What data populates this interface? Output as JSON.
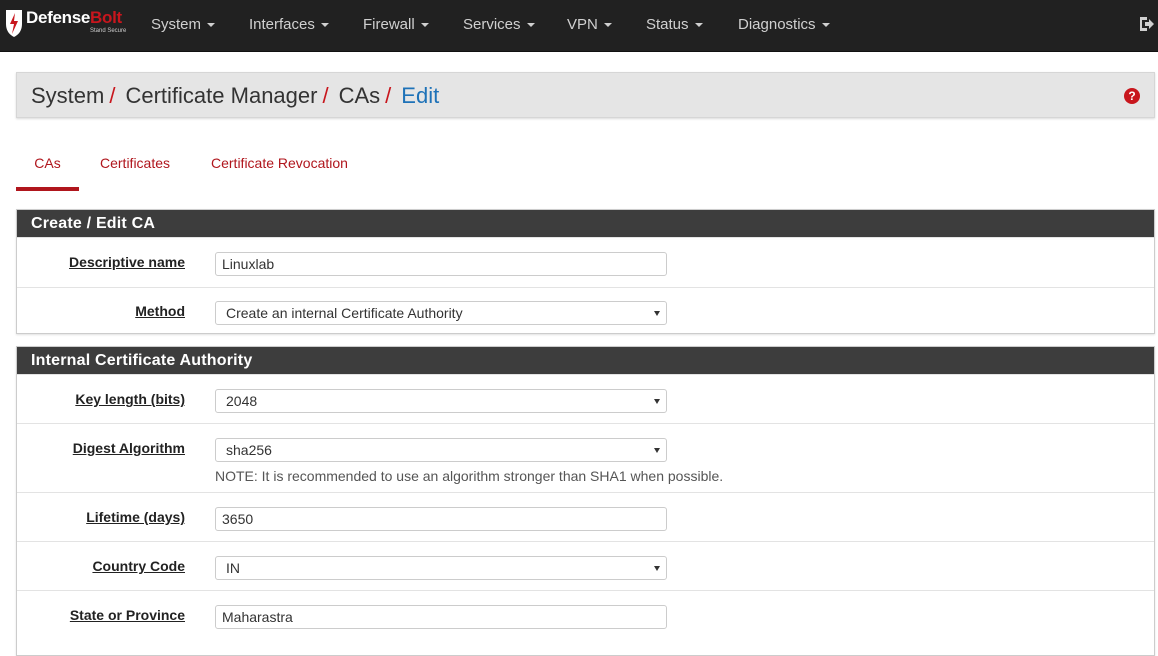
{
  "brand": {
    "name_white": "Defense",
    "name_red": "Bolt",
    "tagline": "Stand Secure"
  },
  "nav": {
    "items": [
      "System",
      "Interfaces",
      "Firewall",
      "Services",
      "VPN",
      "Status",
      "Diagnostics"
    ]
  },
  "breadcrumb": {
    "items": [
      "System",
      "Certificate Manager",
      "CAs"
    ],
    "current": "Edit"
  },
  "tabs": [
    "CAs",
    "Certificates",
    "Certificate Revocation"
  ],
  "panel1": {
    "heading": "Create / Edit CA",
    "descriptive_name_label": "Descriptive name",
    "descriptive_name_value": "Linuxlab",
    "method_label": "Method",
    "method_value": "Create an internal Certificate Authority"
  },
  "panel2": {
    "heading": "Internal Certificate Authority",
    "key_length_label": "Key length (bits)",
    "key_length_value": "2048",
    "digest_label": "Digest Algorithm",
    "digest_value": "sha256",
    "digest_note": "NOTE: It is recommended to use an algorithm stronger than SHA1 when possible.",
    "lifetime_label": "Lifetime (days)",
    "lifetime_value": "3650",
    "country_label": "Country Code",
    "country_value": "IN",
    "state_label": "State or Province",
    "state_value": "Maharastra"
  },
  "colors": {
    "accent": "#b0161d",
    "navbar": "#212121",
    "link": "#1e72b8",
    "panel_heading": "#3d3d3d"
  }
}
